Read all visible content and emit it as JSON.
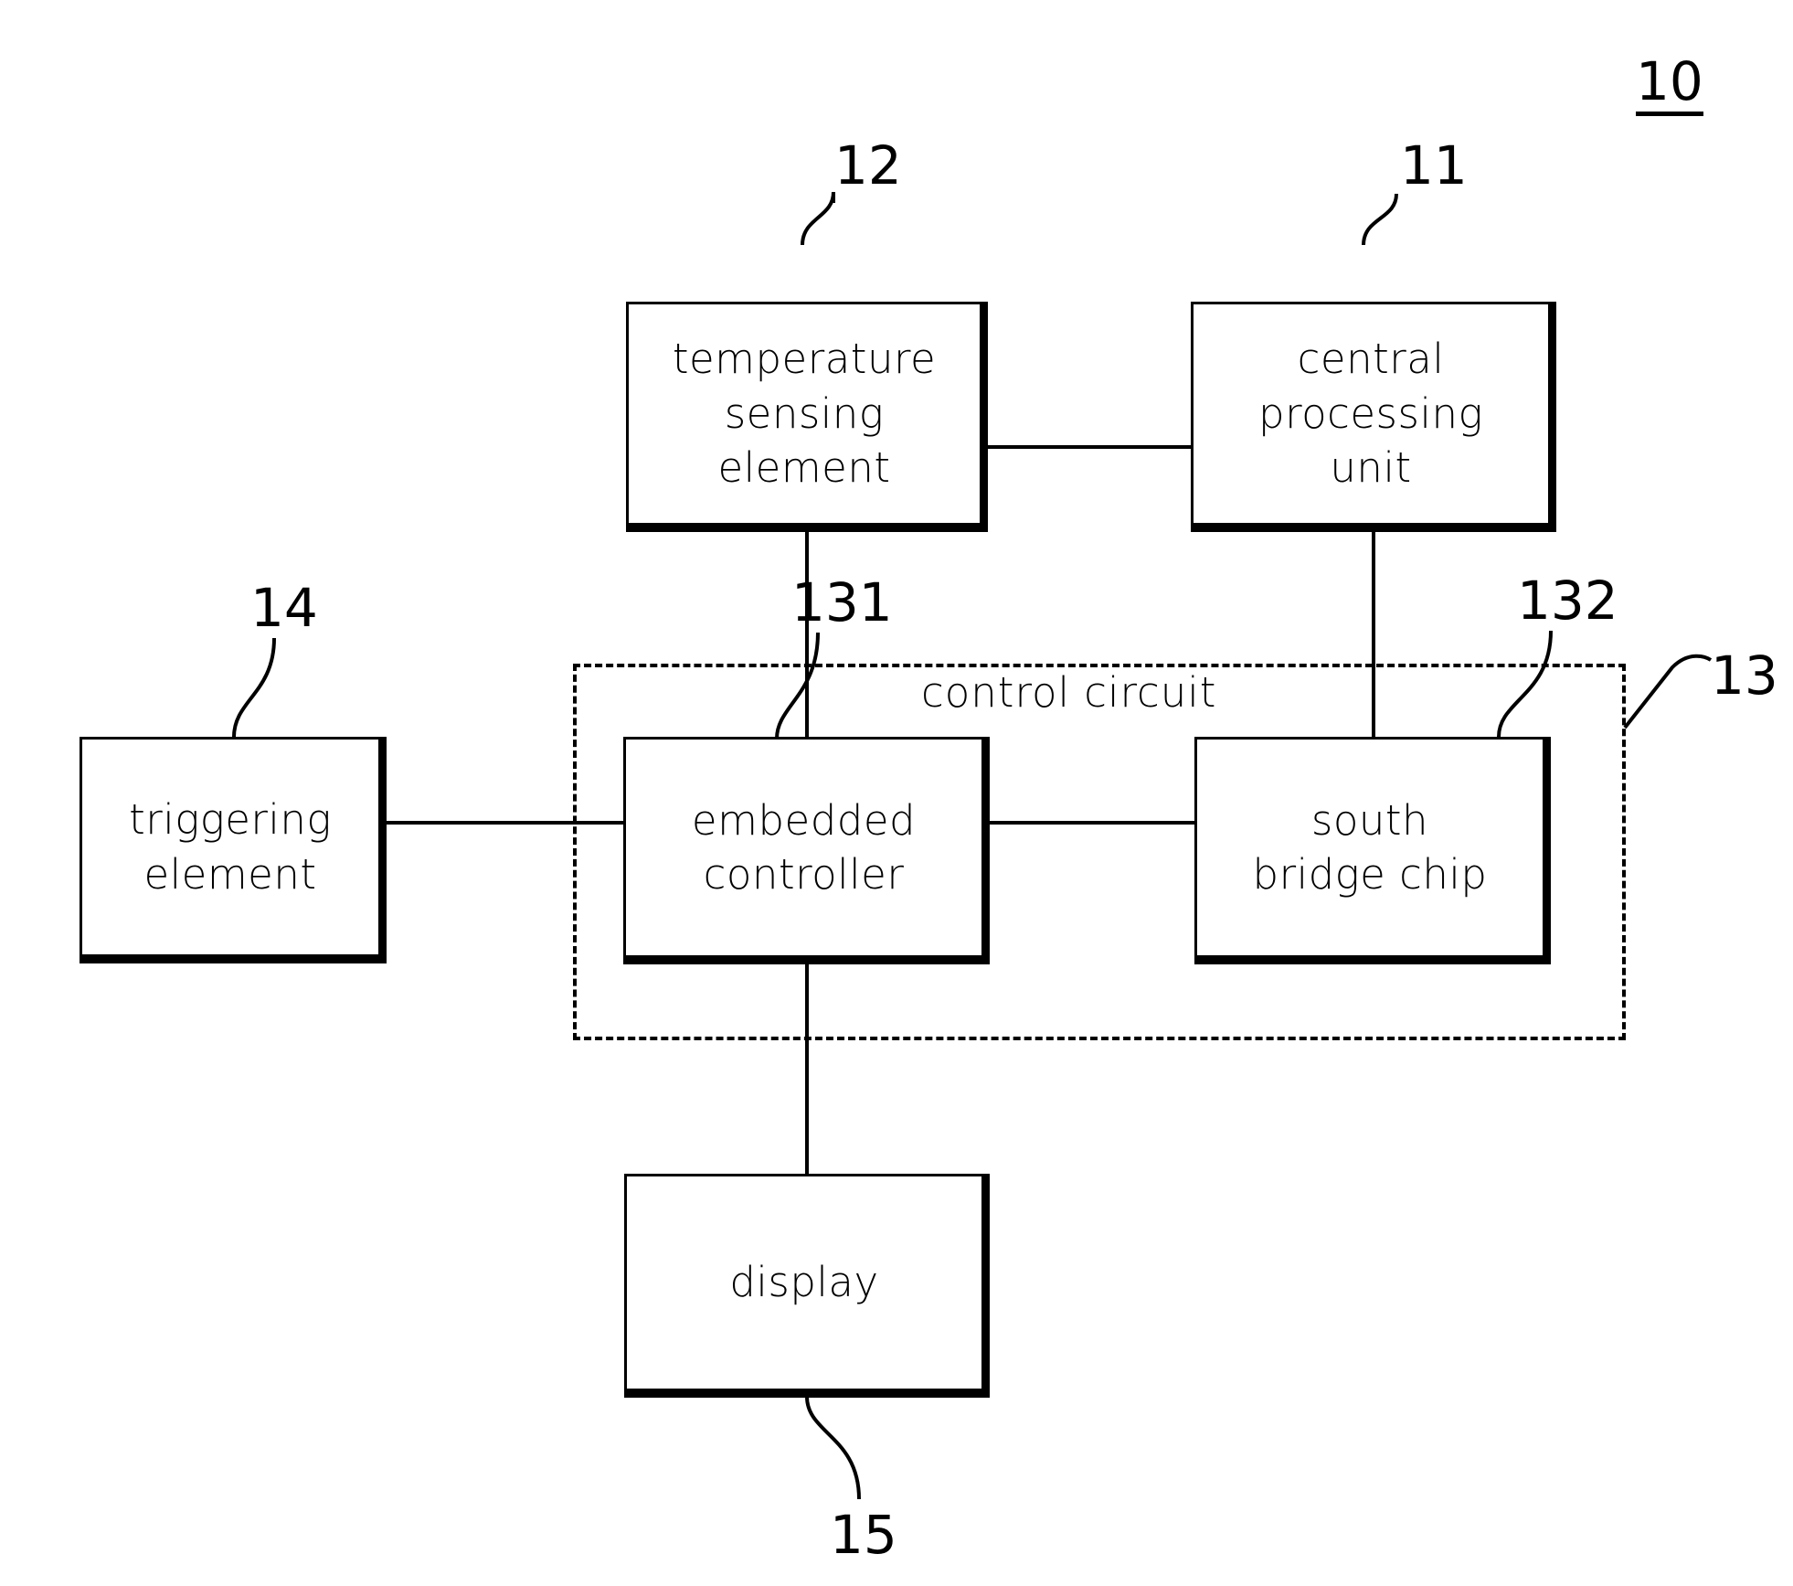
{
  "figure": {
    "title_ref": "10",
    "blocks": [
      {
        "id": "temperature-sensing-element",
        "lines": [
          "temperature",
          "sensing",
          "element"
        ],
        "ref": "12"
      },
      {
        "id": "central-processing-unit",
        "lines": [
          "central",
          "processing",
          "unit"
        ],
        "ref": "11"
      },
      {
        "id": "triggering-element",
        "lines": [
          "triggering",
          "element"
        ],
        "ref": "14"
      },
      {
        "id": "embedded-controller",
        "lines": [
          "embedded",
          "controller"
        ],
        "ref": "131"
      },
      {
        "id": "south-bridge-chip",
        "lines": [
          "south",
          "bridge chip"
        ],
        "ref": "132"
      },
      {
        "id": "display",
        "lines": [
          "display"
        ],
        "ref": "15"
      }
    ],
    "group": {
      "id": "control-circuit",
      "label": "control circuit",
      "ref": "13"
    },
    "colors": {
      "stroke": "#000000",
      "background": "#ffffff"
    }
  }
}
